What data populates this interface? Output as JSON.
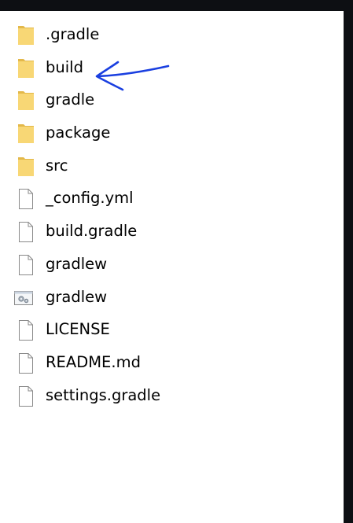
{
  "explorer": {
    "items": [
      {
        "name": ".gradle",
        "icon": "folder-icon"
      },
      {
        "name": "build",
        "icon": "folder-icon"
      },
      {
        "name": "gradle",
        "icon": "folder-icon"
      },
      {
        "name": "package",
        "icon": "folder-icon"
      },
      {
        "name": "src",
        "icon": "folder-icon"
      },
      {
        "name": "_config.yml",
        "icon": "file-icon"
      },
      {
        "name": "build.gradle",
        "icon": "file-icon"
      },
      {
        "name": "gradlew",
        "icon": "file-icon"
      },
      {
        "name": "gradlew",
        "icon": "batch-file-icon"
      },
      {
        "name": "LICENSE",
        "icon": "file-icon"
      },
      {
        "name": "README.md",
        "icon": "file-icon"
      },
      {
        "name": "settings.gradle",
        "icon": "file-icon"
      }
    ]
  },
  "colors": {
    "background": "#0d0f13",
    "panel": "#ffffff",
    "folder": "#f8d775",
    "folder_dark": "#e3b84a",
    "annotation_arrow": "#1a3fe0"
  }
}
